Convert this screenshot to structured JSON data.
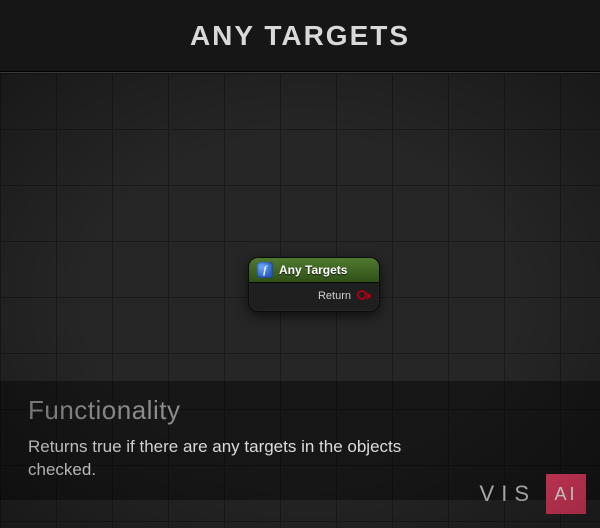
{
  "header": {
    "title": "ANY TARGETS"
  },
  "node": {
    "icon_glyph": "f",
    "title": "Any Targets",
    "pins": {
      "return_label": "Return"
    }
  },
  "panel": {
    "heading": "Functionality",
    "body": "Returns true if there are any targets in the objects checked."
  },
  "logo": {
    "left": "VIS",
    "right": "AI"
  },
  "colors": {
    "accent_pink": "#e83e63",
    "node_header_top": "#4f7a2f",
    "node_header_bottom": "#2f5018",
    "pin_bool": "#a80016"
  }
}
